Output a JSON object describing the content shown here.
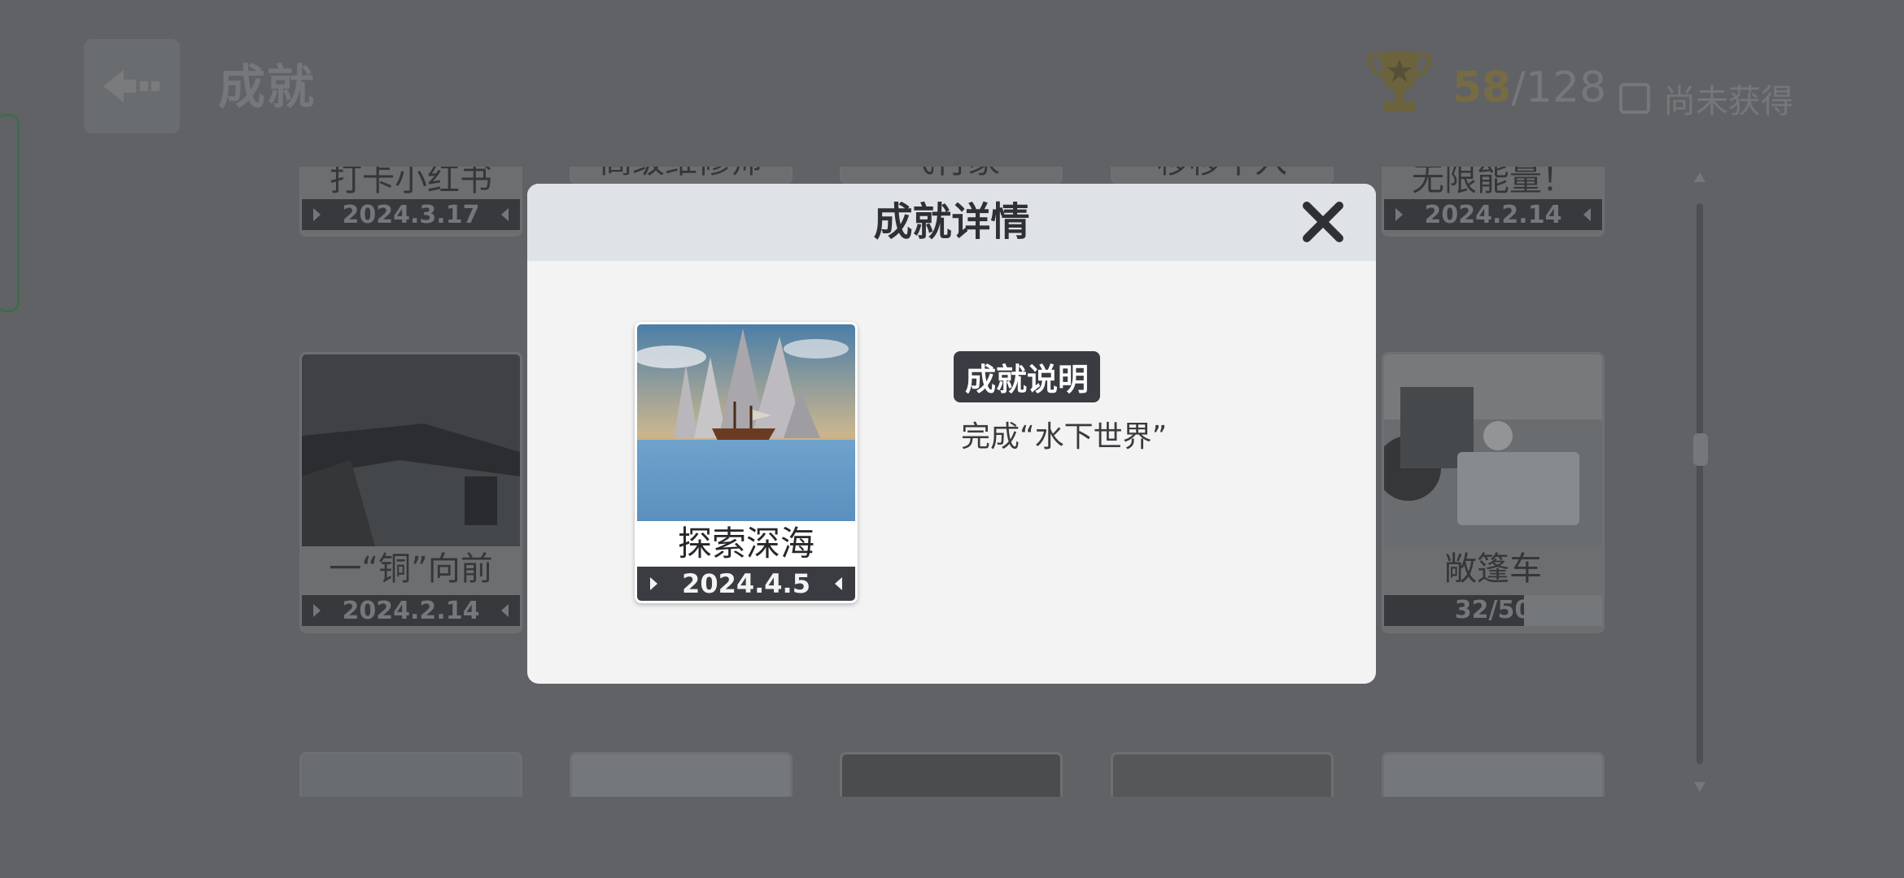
{
  "header": {
    "title": "成就",
    "achieved": "58",
    "total": "/128",
    "filter_label": "尚未获得"
  },
  "grid": {
    "row1": [
      {
        "name": "打卡小红书",
        "date": "2024.3.17"
      },
      {
        "name": "高级维修师",
        "date": ""
      },
      {
        "name": "飞行家",
        "date": ""
      },
      {
        "name": "移移不入",
        "date": ""
      },
      {
        "name": "无限能量！",
        "date": "2024.2.14"
      }
    ],
    "row2": [
      {
        "name": "一“铜”向前",
        "date": "2024.2.14"
      },
      {
        "name": "敞篷车",
        "progress_text": "32/50",
        "progress": 0.64
      }
    ]
  },
  "modal": {
    "title": "成就详情",
    "achievement_name": "探索深海",
    "achievement_date": "2024.4.5",
    "desc_label": "成就说明",
    "desc_text": "完成“水下世界”"
  },
  "colors": {
    "backdrop": "#7b7d7f",
    "modal_bg": "#f3f3f4",
    "modal_header": "#dfe2e7",
    "dark_strip": "#3a3c42",
    "gold": "#9c8a4e"
  },
  "icons": {
    "back": "back-arrow-icon",
    "trophy": "trophy-icon",
    "close": "close-icon"
  }
}
